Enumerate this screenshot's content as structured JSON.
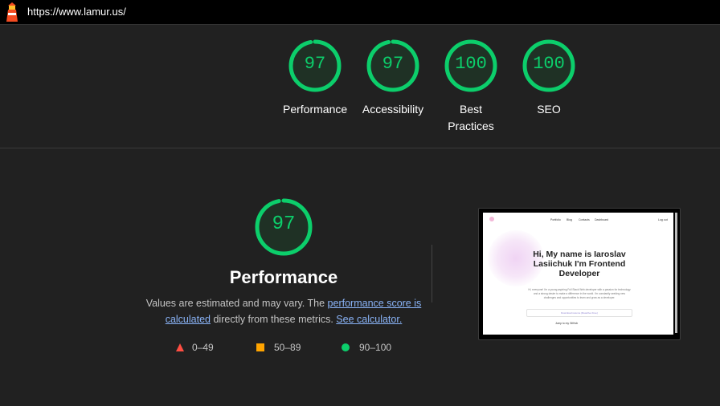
{
  "browser": {
    "url": "https://www.lamur.us/"
  },
  "colors": {
    "pass": "#0cce6b",
    "average": "#ffa400",
    "fail": "#ff4e42",
    "link": "#8ab4f8"
  },
  "summary": [
    {
      "score": "97",
      "label": "Performance"
    },
    {
      "score": "97",
      "label": "Accessibility"
    },
    {
      "score": "100",
      "label": "Best Practices"
    },
    {
      "score": "100",
      "label": "SEO"
    }
  ],
  "performance": {
    "score": "97",
    "score_fraction": 0.97,
    "title": "Performance",
    "desc_prefix": "Values are estimated and may vary. The ",
    "link_score": "performance score is calculated",
    "desc_middle": " directly from these metrics. ",
    "link_calc": "See calculator."
  },
  "legend": [
    {
      "icon": "triangle-icon",
      "range": "0–49"
    },
    {
      "icon": "square-icon",
      "range": "50–89"
    },
    {
      "icon": "circle-icon",
      "range": "90–100"
    }
  ],
  "screenshot": {
    "nav": [
      "Portfolio",
      "Blog",
      "Contacts",
      "Dashboard"
    ],
    "nav_right": "Log out",
    "hero": "Hi, My name is Iaroslav Lasiichuk I'm Frontend Developer",
    "paragraph": "Hi, everyone! I'm a young aspiring Full Stack Web developer with a passion for technology and a strong desire to make a difference in the world. I'm constantly seeking new challenges and opportunities to learn and grow as a developer.",
    "cta": "Download resume (Reactive Free)",
    "link": "Jump to my GitHub"
  }
}
